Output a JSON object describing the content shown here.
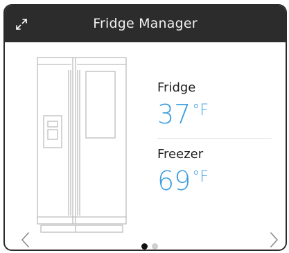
{
  "header": {
    "title": "Fridge Manager",
    "expand_icon": "expand-arrows-icon"
  },
  "fridge": {
    "label": "Fridge",
    "temperature": "37",
    "unit": "°F"
  },
  "freezer": {
    "label": "Freezer",
    "temperature": "69",
    "unit": "°F"
  },
  "pagination": {
    "total_pages": 2,
    "current_page": 1
  },
  "navigation": {
    "prev_icon": "chevron-left-icon",
    "next_icon": "chevron-right-icon"
  },
  "colors": {
    "header_bg": "#2c2c2c",
    "temperature": "#3a9de0",
    "dot_active": "#111111",
    "dot_inactive": "#cfcfcf"
  }
}
